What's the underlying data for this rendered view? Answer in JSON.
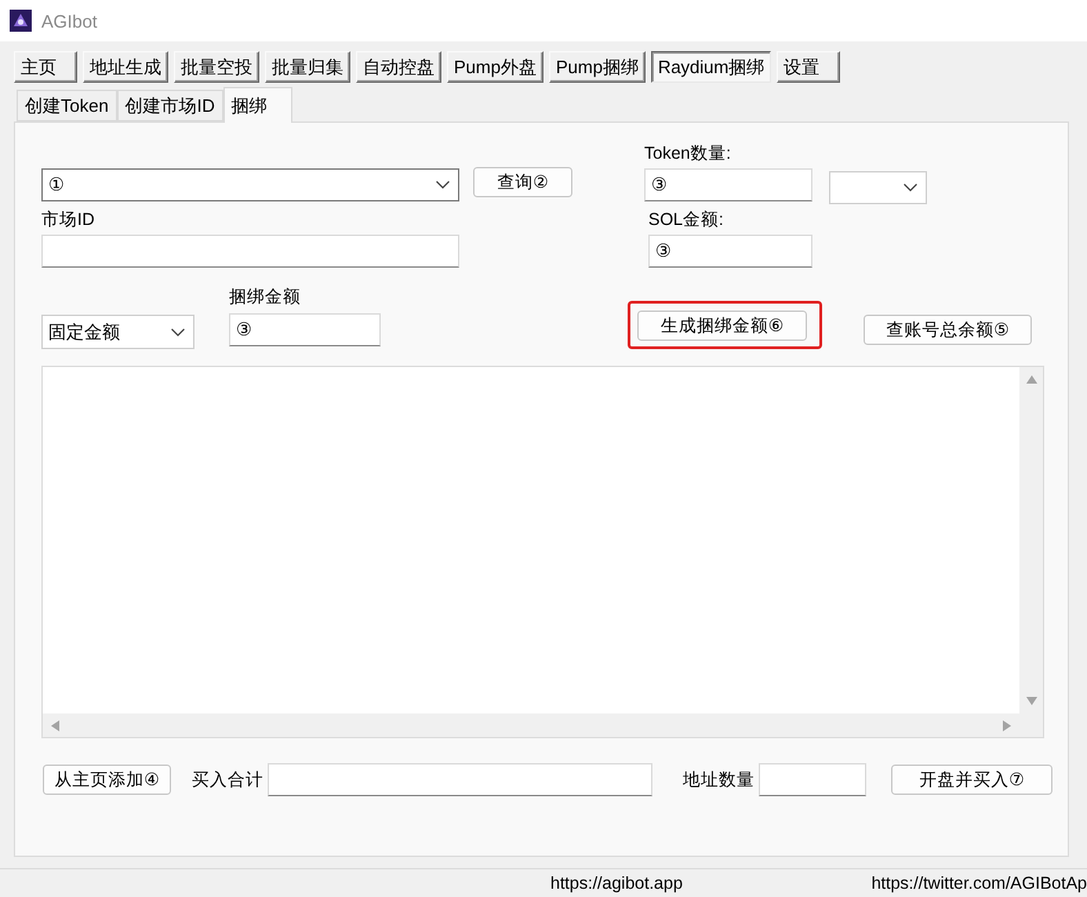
{
  "window": {
    "title": "AGIbot"
  },
  "main_tabs": [
    {
      "label": "主页",
      "selected": false
    },
    {
      "label": "地址生成",
      "selected": false
    },
    {
      "label": "批量空投",
      "selected": false
    },
    {
      "label": "批量归集",
      "selected": false
    },
    {
      "label": "自动控盘",
      "selected": false
    },
    {
      "label": "Pump外盘",
      "selected": false
    },
    {
      "label": "Pump捆绑",
      "selected": false
    },
    {
      "label": "Raydium捆绑",
      "selected": true
    },
    {
      "label": "设置",
      "selected": false
    }
  ],
  "sub_tabs": [
    {
      "label": "创建Token",
      "selected": false
    },
    {
      "label": "创建市场ID",
      "selected": false
    },
    {
      "label": "捆绑",
      "selected": true
    }
  ],
  "form": {
    "token_combo": {
      "value": "①"
    },
    "query_button": "查询②",
    "token_amount": {
      "label": "Token数量:",
      "value": "③"
    },
    "sol_amount": {
      "label": "SOL金额:",
      "value": "③"
    },
    "market_id": {
      "label": "市场ID"
    },
    "amount_mode": {
      "value": "固定金额"
    },
    "bundle_amount": {
      "label": "捆绑金额",
      "value": "③"
    },
    "generate_button": {
      "label": "生成捆绑金额⑥",
      "highlighted": true
    },
    "balance_button": "查账号总余额⑤"
  },
  "bottom": {
    "add_button": "从主页添加④",
    "buy_total_label": "买入合计",
    "address_count_label": "地址数量",
    "launch_button": "开盘并买入⑦"
  },
  "status_bar": [
    "https://agibot.app",
    "https://twitter.com/AGIBotAp"
  ]
}
